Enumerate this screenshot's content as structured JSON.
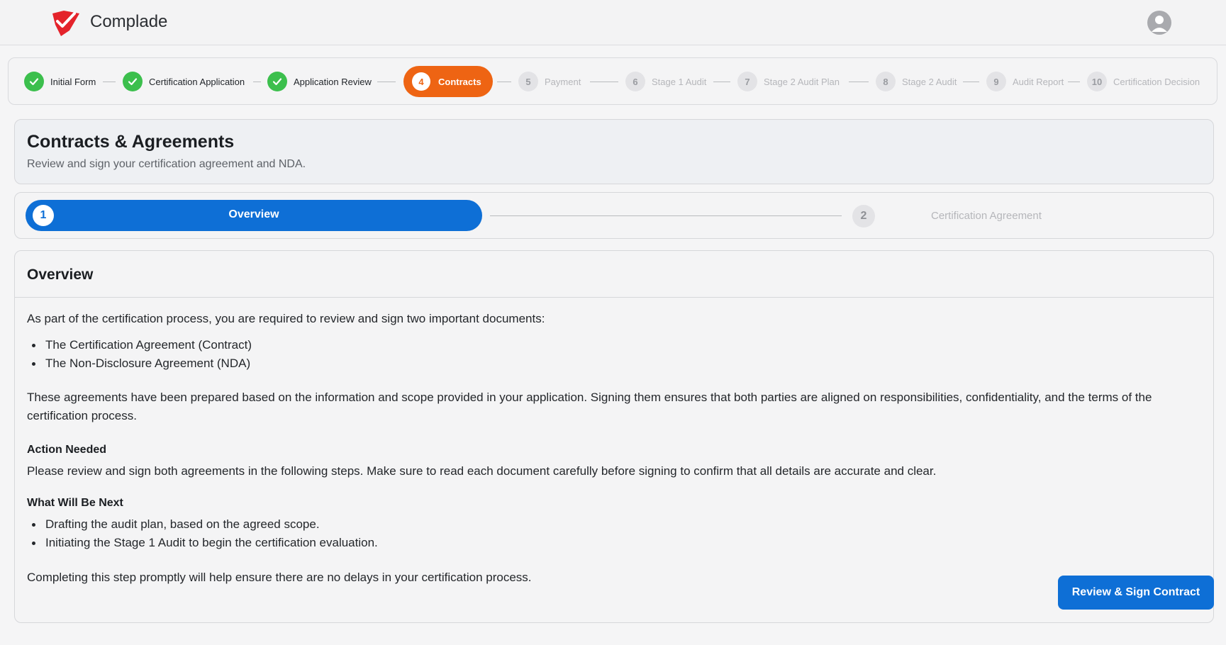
{
  "header": {
    "brand": "Complade",
    "logo_icon": "check-shield-logo",
    "avatar_icon": "user-avatar-icon",
    "brand_color": "#e4232b"
  },
  "progress": {
    "steps": [
      {
        "num": "1",
        "label": "Initial Form",
        "state": "done"
      },
      {
        "num": "2",
        "label": "Certification Application",
        "state": "done"
      },
      {
        "num": "3",
        "label": "Application Review",
        "state": "done"
      },
      {
        "num": "4",
        "label": "Contracts",
        "state": "current"
      },
      {
        "num": "5",
        "label": "Payment",
        "state": "pending"
      },
      {
        "num": "6",
        "label": "Stage 1 Audit",
        "state": "pending"
      },
      {
        "num": "7",
        "label": "Stage 2 Audit Plan",
        "state": "pending"
      },
      {
        "num": "8",
        "label": "Stage 2 Audit",
        "state": "pending"
      },
      {
        "num": "9",
        "label": "Audit Report",
        "state": "pending"
      },
      {
        "num": "10",
        "label": "Certification Decision",
        "state": "pending"
      }
    ],
    "done_color": "#3cbf4d",
    "current_color": "#ee6413"
  },
  "page": {
    "title": "Contracts & Agreements",
    "subtitle": "Review and sign your certification agreement and NDA."
  },
  "substeps": [
    {
      "num": "1",
      "label": "Overview",
      "state": "active"
    },
    {
      "num": "2",
      "label": "Certification Agreement",
      "state": "pending"
    }
  ],
  "overview": {
    "heading": "Overview",
    "intro": "As part of the certification process, you are required to review and sign two important documents:",
    "documents": [
      "The Certification Agreement (Contract)",
      "The Non-Disclosure Agreement (NDA)"
    ],
    "para1_line1": "These agreements have been prepared based on the information and scope provided in your application. Signing them ensures that both parties are aligned on responsibilities,  confidentiality, and the terms of the",
    "para1_line2": "certification process.",
    "action_heading": "Action Needed",
    "action_text": "Please review and sign both agreements in the following steps. Make sure to read each document carefully before signing to confirm that all details are accurate and clear.",
    "next_heading": "What Will Be Next",
    "next_items": [
      "Drafting the audit plan, based on the agreed scope.",
      "Initiating the Stage 1 Audit to begin the certification evaluation."
    ],
    "closing": "Completing this step promptly will help ensure there are no delays in your certification process.",
    "cta_label": "Review & Sign Contract",
    "accent_color": "#0e6fd6"
  }
}
